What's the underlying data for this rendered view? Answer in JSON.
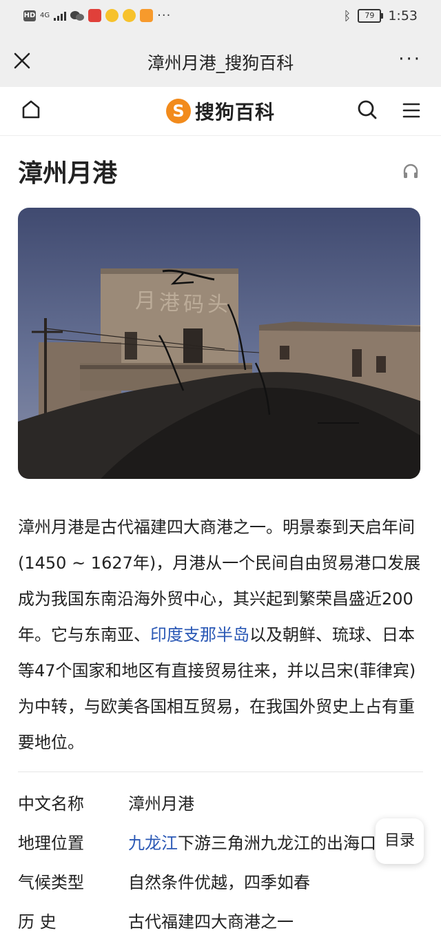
{
  "status_bar": {
    "hd": "HD",
    "network": "4G",
    "battery": "79",
    "time": "1:53",
    "more": "···"
  },
  "title_bar": {
    "title": "漳州月港_搜狗百科",
    "more": "···"
  },
  "site": {
    "logo_mark": "S",
    "logo_text": "搜狗百科"
  },
  "article": {
    "title": "漳州月港",
    "intro_part1": "漳州月港是古代福建四大商港之一。明景泰到天启年间(1450 ~ 1627年)，月港从一个民间自由贸易港口发展成为我国东南沿海外贸中心，其兴起到繁荣昌盛近200年。它与东南亚、",
    "intro_link": "印度支那半岛",
    "intro_part2": "以及朝鲜、琉球、日本等47个国家和地区有直接贸易往来，并以吕宋(菲律宾)为中转，与欧美各国相互贸易，在我国外贸史上占有重要地位。"
  },
  "info": {
    "rows": [
      {
        "key": "中文名称",
        "value": "漳州月港"
      },
      {
        "key": "地理位置",
        "link": "九龙江",
        "value": "下游三角洲九龙江的出海口"
      },
      {
        "key": "气候类型",
        "value": "自然条件优越，四季如春"
      },
      {
        "key": "历 史",
        "value": "古代福建四大商港之一"
      }
    ]
  },
  "toc_label": "目录",
  "colors": {
    "link": "#2a58b5",
    "brand_orange": "#f28b1c",
    "bar_bg": "#efefef"
  }
}
